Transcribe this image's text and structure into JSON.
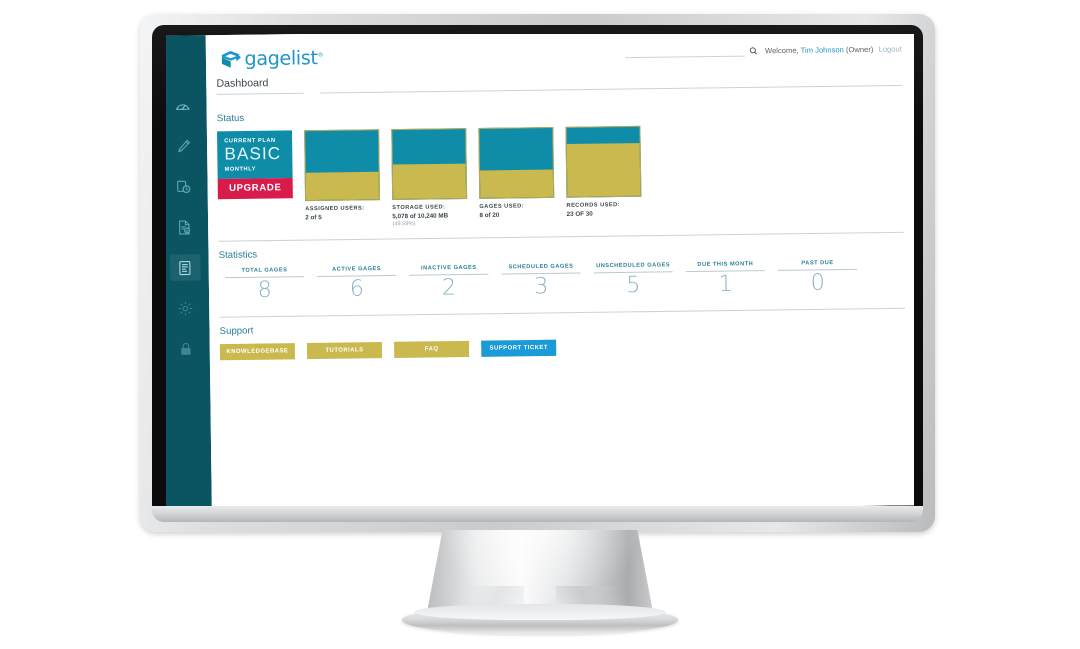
{
  "app": {
    "logo_text": "gagelist",
    "logo_reg": "®",
    "logo_mark": "gagelist-cube-arrow-logo"
  },
  "header": {
    "search_placeholder": "",
    "search_value": "",
    "search_icon": "search-icon",
    "welcome_prefix": "Welcome,",
    "user_name": "Tim Johnson",
    "user_role": "(Owner)",
    "logout_label": "Logout"
  },
  "breadcrumb": {
    "current": "Dashboard"
  },
  "sidebar": {
    "items": [
      {
        "icon": "dashboard-gauge-icon",
        "label": "Dashboard",
        "active": false
      },
      {
        "icon": "caliper-tool-icon",
        "label": "Gages",
        "active": false
      },
      {
        "icon": "gage-clock-icon",
        "label": "Calibrations",
        "active": false
      },
      {
        "icon": "document-check-icon",
        "label": "Records",
        "active": false
      },
      {
        "icon": "report-list-icon",
        "label": "Reports",
        "active": true
      },
      {
        "icon": "gear-settings-icon",
        "label": "Settings",
        "active": false
      },
      {
        "icon": "lock-icon",
        "label": "Security",
        "active": false
      }
    ]
  },
  "status": {
    "title": "Status",
    "plan": {
      "label": "CURRENT PLAN",
      "name": "BASIC",
      "cycle": "MONTHLY",
      "upgrade_label": "UPGRADE",
      "accent_color": "#0f8da8",
      "upgrade_color": "#d81b4b"
    },
    "gauges": [
      {
        "label": "ASSIGNED USERS:",
        "value": "2 of 5",
        "sub": "",
        "fill_percent": 40,
        "used": 2,
        "total": 5
      },
      {
        "label": "STORAGE USED:",
        "value": "5,078 of 10,240 MB",
        "sub": "(49.59%)",
        "fill_percent": 50,
        "used": 5078,
        "total": 10240
      },
      {
        "label": "GAGES USED:",
        "value": "8 of 20",
        "sub": "",
        "fill_percent": 40,
        "used": 8,
        "total": 20
      },
      {
        "label": "RECORDS USED:",
        "value": "23 OF 30",
        "sub": "",
        "fill_percent": 77,
        "used": 23,
        "total": 30
      }
    ],
    "fill_color": "#c9b94f",
    "empty_color": "#0f8da8"
  },
  "statistics": {
    "title": "Statistics",
    "items": [
      {
        "label": "TOTAL GAGES",
        "value": "8"
      },
      {
        "label": "ACTIVE GAGES",
        "value": "6"
      },
      {
        "label": "INACTIVE GAGES",
        "value": "2"
      },
      {
        "label": "SCHEDULED GAGES",
        "value": "3"
      },
      {
        "label": "UNSCHEDULED GAGES",
        "value": "5"
      },
      {
        "label": "DUE THIS MONTH",
        "value": "1"
      },
      {
        "label": "PAST DUE",
        "value": "0"
      }
    ]
  },
  "support": {
    "title": "Support",
    "buttons": [
      {
        "label": "KNOWLEDGEBASE",
        "style": "gold"
      },
      {
        "label": "TUTORIALS",
        "style": "gold"
      },
      {
        "label": "FAQ",
        "style": "gold"
      },
      {
        "label": "SUPPORT TICKET",
        "style": "blue"
      }
    ]
  },
  "theme": {
    "sidebar_color": "#0b5563",
    "teal": "#0f8da8",
    "gold": "#c9b94f",
    "blue": "#1a9ad7",
    "crimson": "#d81b4b",
    "link": "#2196c9"
  }
}
